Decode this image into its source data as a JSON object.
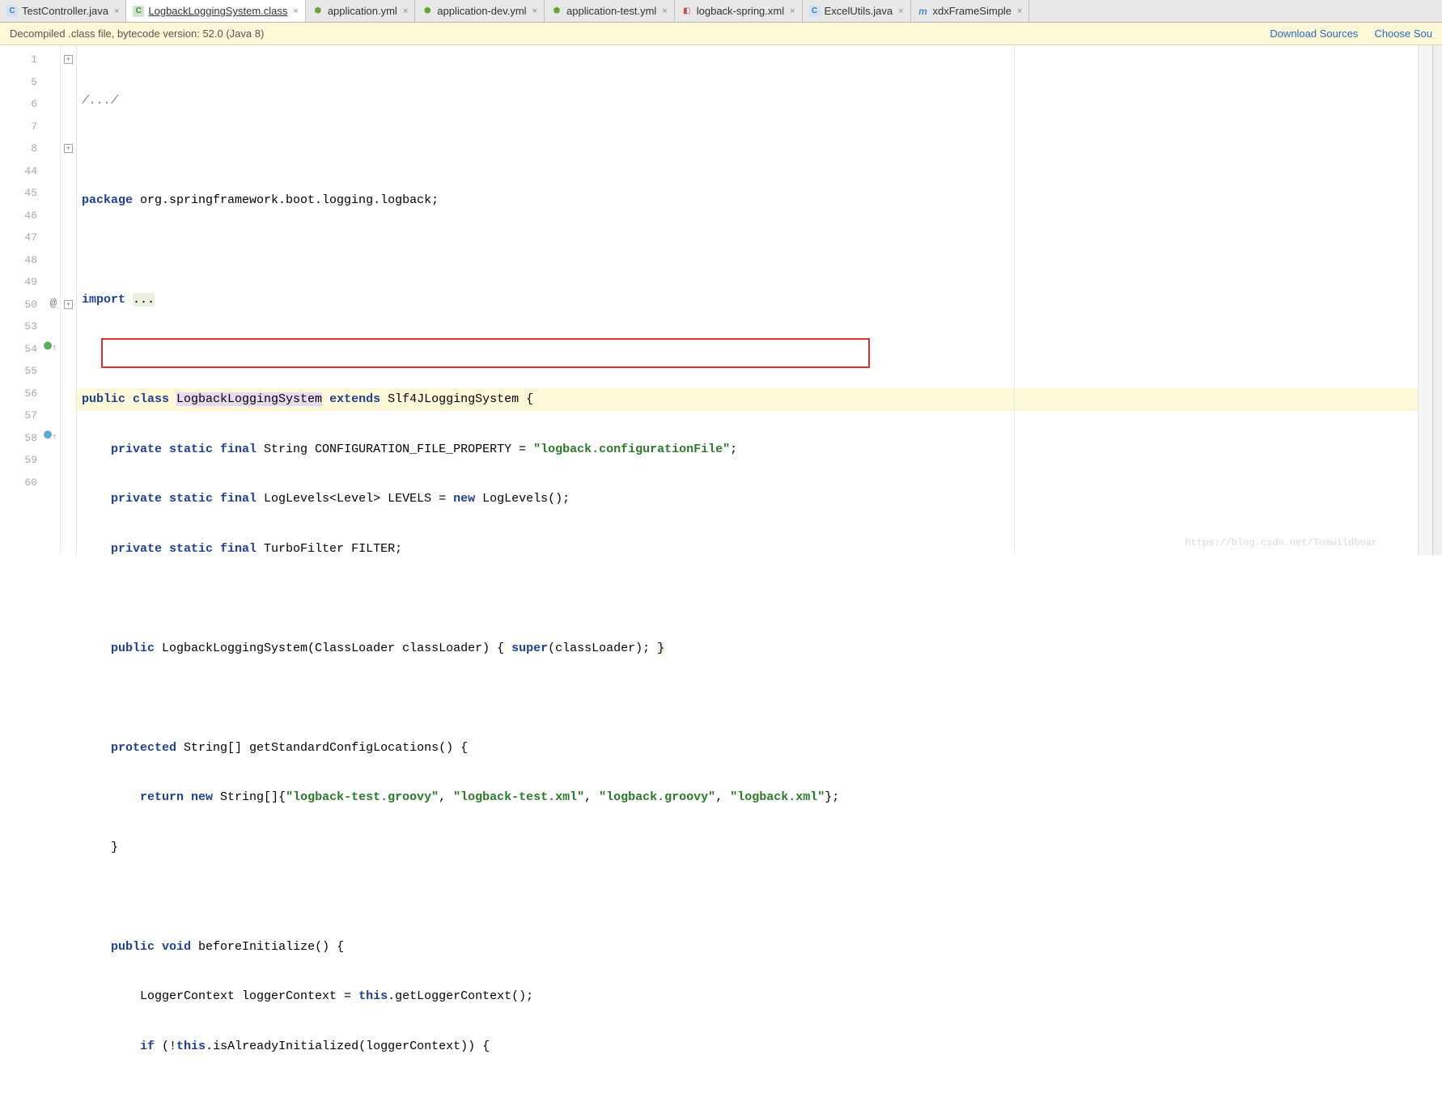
{
  "tabs": [
    {
      "icon": "C",
      "iconClass": "icon-c",
      "label": "TestController.java",
      "closable": true,
      "active": false
    },
    {
      "icon": "C",
      "iconClass": "icon-c-active",
      "label": "LogbackLoggingSystem.class",
      "closable": true,
      "active": true
    },
    {
      "icon": "⬢",
      "iconClass": "icon-yml",
      "label": "application.yml",
      "closable": true,
      "active": false
    },
    {
      "icon": "⬢",
      "iconClass": "icon-yml",
      "label": "application-dev.yml",
      "closable": true,
      "active": false
    },
    {
      "icon": "⬢",
      "iconClass": "icon-yml",
      "label": "application-test.yml",
      "closable": true,
      "active": false
    },
    {
      "icon": "◧",
      "iconClass": "icon-xml",
      "label": "logback-spring.xml",
      "closable": true,
      "active": false
    },
    {
      "icon": "C",
      "iconClass": "icon-c",
      "label": "ExcelUtils.java",
      "closable": true,
      "active": false
    },
    {
      "icon": "m",
      "iconClass": "icon-m",
      "label": "xdxFrameSimple",
      "closable": true,
      "active": false
    }
  ],
  "banner": {
    "message": "Decompiled .class file, bytecode version: 52.0 (Java 8)",
    "download": "Download Sources",
    "choose": "Choose Sou"
  },
  "gutter": {
    "lines": [
      "1",
      "5",
      "6",
      "7",
      "8",
      "44",
      "45",
      "46",
      "47",
      "48",
      "49",
      "50",
      "53",
      "54",
      "55",
      "56",
      "57",
      "58",
      "59",
      "60"
    ]
  },
  "code": {
    "comment": "/.../",
    "pkg_kw": "package",
    "pkg": " org.springframework.boot.logging.logback;",
    "imp_kw": "import",
    "imp_dots": "...",
    "l45_a": "public class ",
    "l45_b": "LogbackLoggingSystem",
    "l45_c": " extends ",
    "l45_d": "Slf4JLoggingSystem {",
    "l46_a": "private static final ",
    "l46_b": "String CONFIGURATION_FILE_PROPERTY = ",
    "l46_c": "\"logback.configurationFile\"",
    "l46_d": ";",
    "l47_a": "private static final ",
    "l47_b": "LogLevels<Level> LEVELS = ",
    "l47_c": "new ",
    "l47_d": "LogLevels();",
    "l48_a": "private static final ",
    "l48_b": "TurboFilter FILTER;",
    "l50_a": "public ",
    "l50_b": "LogbackLoggingSystem(ClassLoader classLoader) { ",
    "l50_c": "super",
    "l50_d": "(classLoader); ",
    "l50_e": "}",
    "l54_a": "protected ",
    "l54_b": "String[] getStandardConfigLocations() {",
    "l55_a": "return new ",
    "l55_b": "String[]{",
    "l55_c": "\"logback-test.groovy\"",
    "l55_d": ", ",
    "l55_e": "\"logback-test.xml\"",
    "l55_f": ", ",
    "l55_g": "\"logback.groovy\"",
    "l55_h": ", ",
    "l55_i": "\"logback.xml\"",
    "l55_j": "};",
    "l56": "}",
    "l58_a": "public void ",
    "l58_b": "beforeInitialize() {",
    "l59_a": "LoggerContext loggerContext = ",
    "l59_b": "this",
    "l59_c": ".getLoggerContext();",
    "l60_a": "if ",
    "l60_b": "(!",
    "l60_c": "this",
    "l60_d": ".isAlreadyInitialized(loggerContext)) {"
  },
  "watermark": "https://blog.csdn.net/Tomwildboar"
}
